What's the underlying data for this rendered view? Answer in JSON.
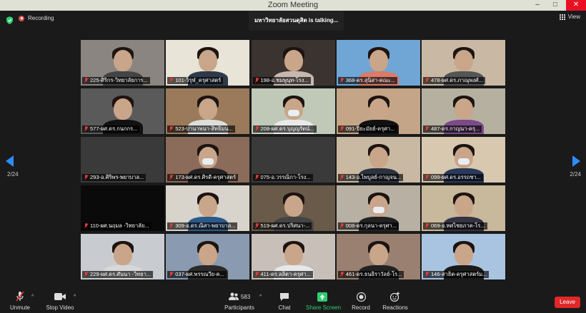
{
  "window": {
    "title": "Zoom Meeting",
    "controls": [
      "–",
      "□",
      "✕"
    ]
  },
  "topbar": {
    "recording_label": "Recording",
    "talking": "มหาวิทยาลัยสวนดุสิต is talking...",
    "view_label": "View"
  },
  "pagination": {
    "left": "2/24",
    "right": "2/24"
  },
  "participants": [
    {
      "name": "225-ศิริกร-วิทยาลัยการ...",
      "bg": "#8a8580",
      "shirt": "#444"
    },
    {
      "name": "101-วิรุฬ_ครุศาสตร์",
      "bg": "#e8e4d8",
      "shirt": "#2e3a4a"
    },
    {
      "name": "198-อ.ชมพูนุท-โรง...",
      "bg": "#3b3330",
      "shirt": "#c8b8b0"
    },
    {
      "name": "368-ดร.สุนิสา-คณะ...",
      "bg": "#6fa6d6",
      "shirt": "#d97b6b"
    },
    {
      "name": "478-ผศ.ดร.ภาณุพงศ์...",
      "bg": "#c9b9a4",
      "shirt": "#555"
    },
    {
      "name": "577-ผศ.ดร.กนกกร...",
      "bg": "#5a5a5a",
      "shirt": "#111"
    },
    {
      "name": "523-ปานาพนา-สิทธิมน...",
      "bg": "#9a7a5a",
      "shirt": "#ddd"
    },
    {
      "name": "208-ผศ.ดร.บุญญรัตน์...",
      "bg": "#c0c8b8",
      "shirt": "#e9e9e9"
    },
    {
      "name": "091-ปียะมัยย์-ครุศา...",
      "bg": "#c4a588",
      "shirt": "#111"
    },
    {
      "name": "487-ดร.กาญนา-ครุ...",
      "bg": "#b5b0a0",
      "shirt": "#7b4a8a"
    },
    {
      "name": "293-อ.ศิริพร-พยาบาล...",
      "bg": "#3a3a3a",
      "shirt": "#3a3a3a"
    },
    {
      "name": "173-ผศ.ดร.ศิรดี-ครุศาสตร์",
      "bg": "#8b6b5a",
      "shirt": "#222"
    },
    {
      "name": "075-อ.วรรณิกา-โรง...",
      "bg": "#3a3a3a",
      "shirt": "#3a3a3a"
    },
    {
      "name": "143-อ.ไพบูลย์-กาญจน...",
      "bg": "#c9b9a2",
      "shirt": "#2b3240"
    },
    {
      "name": "099-ผศ.ดร.อรรถชา...",
      "bg": "#d8c8b0",
      "shirt": "#2a3a5a"
    },
    {
      "name": "110-ผศ.นฤมล -วิทยาลัย...",
      "bg": "#0a0a0a",
      "shirt": "#0a0a0a"
    },
    {
      "name": "309-อ.ดร.ณิสา-พยาบาล...",
      "bg": "#d8d4cc",
      "shirt": "#2b5a8a"
    },
    {
      "name": "519-ผศ.ดร.ปริศนา-...",
      "bg": "#6a5a4a",
      "shirt": "#444"
    },
    {
      "name": "008-ดร.กุลนา-ครุศา...",
      "bg": "#b9b0a4",
      "shirt": "#222"
    },
    {
      "name": "069-อ.ทศไชยภาค-โร...",
      "bg": "#c8b89c",
      "shirt": "#334"
    },
    {
      "name": "229-ผศ.ดร.ศันนา -วิทยา...",
      "bg": "#c8ccd0",
      "shirt": "#d8d8d8"
    },
    {
      "name": "037-ผศ.พรรณวีย-ค...",
      "bg": "#8a9ab0",
      "shirt": "#2a2a2a"
    },
    {
      "name": "411-ดร.ลลิตา-ครุศา...",
      "bg": "#c8c0b8",
      "shirt": "#e8e8e8"
    },
    {
      "name": "461-ดร.ธนธิราวัลย์-โร...",
      "bg": "#9a8070",
      "shirt": "#222"
    },
    {
      "name": "146-สาธิต-ครุศาสตร์ม...",
      "bg": "#a8c4e0",
      "shirt": "#1a1a1a"
    }
  ],
  "toolbar": {
    "unmute": "Unmute",
    "stop_video": "Stop Video",
    "participants": "Participants",
    "participant_count": "583",
    "chat": "Chat",
    "share": "Share Screen",
    "record": "Record",
    "reactions": "Reactions",
    "leave": "Leave"
  },
  "colors": {
    "share_accent": "#2ecc71",
    "leave": "#e02828",
    "nav_arrow": "#2d8cff",
    "mute_red": "#e53935"
  }
}
